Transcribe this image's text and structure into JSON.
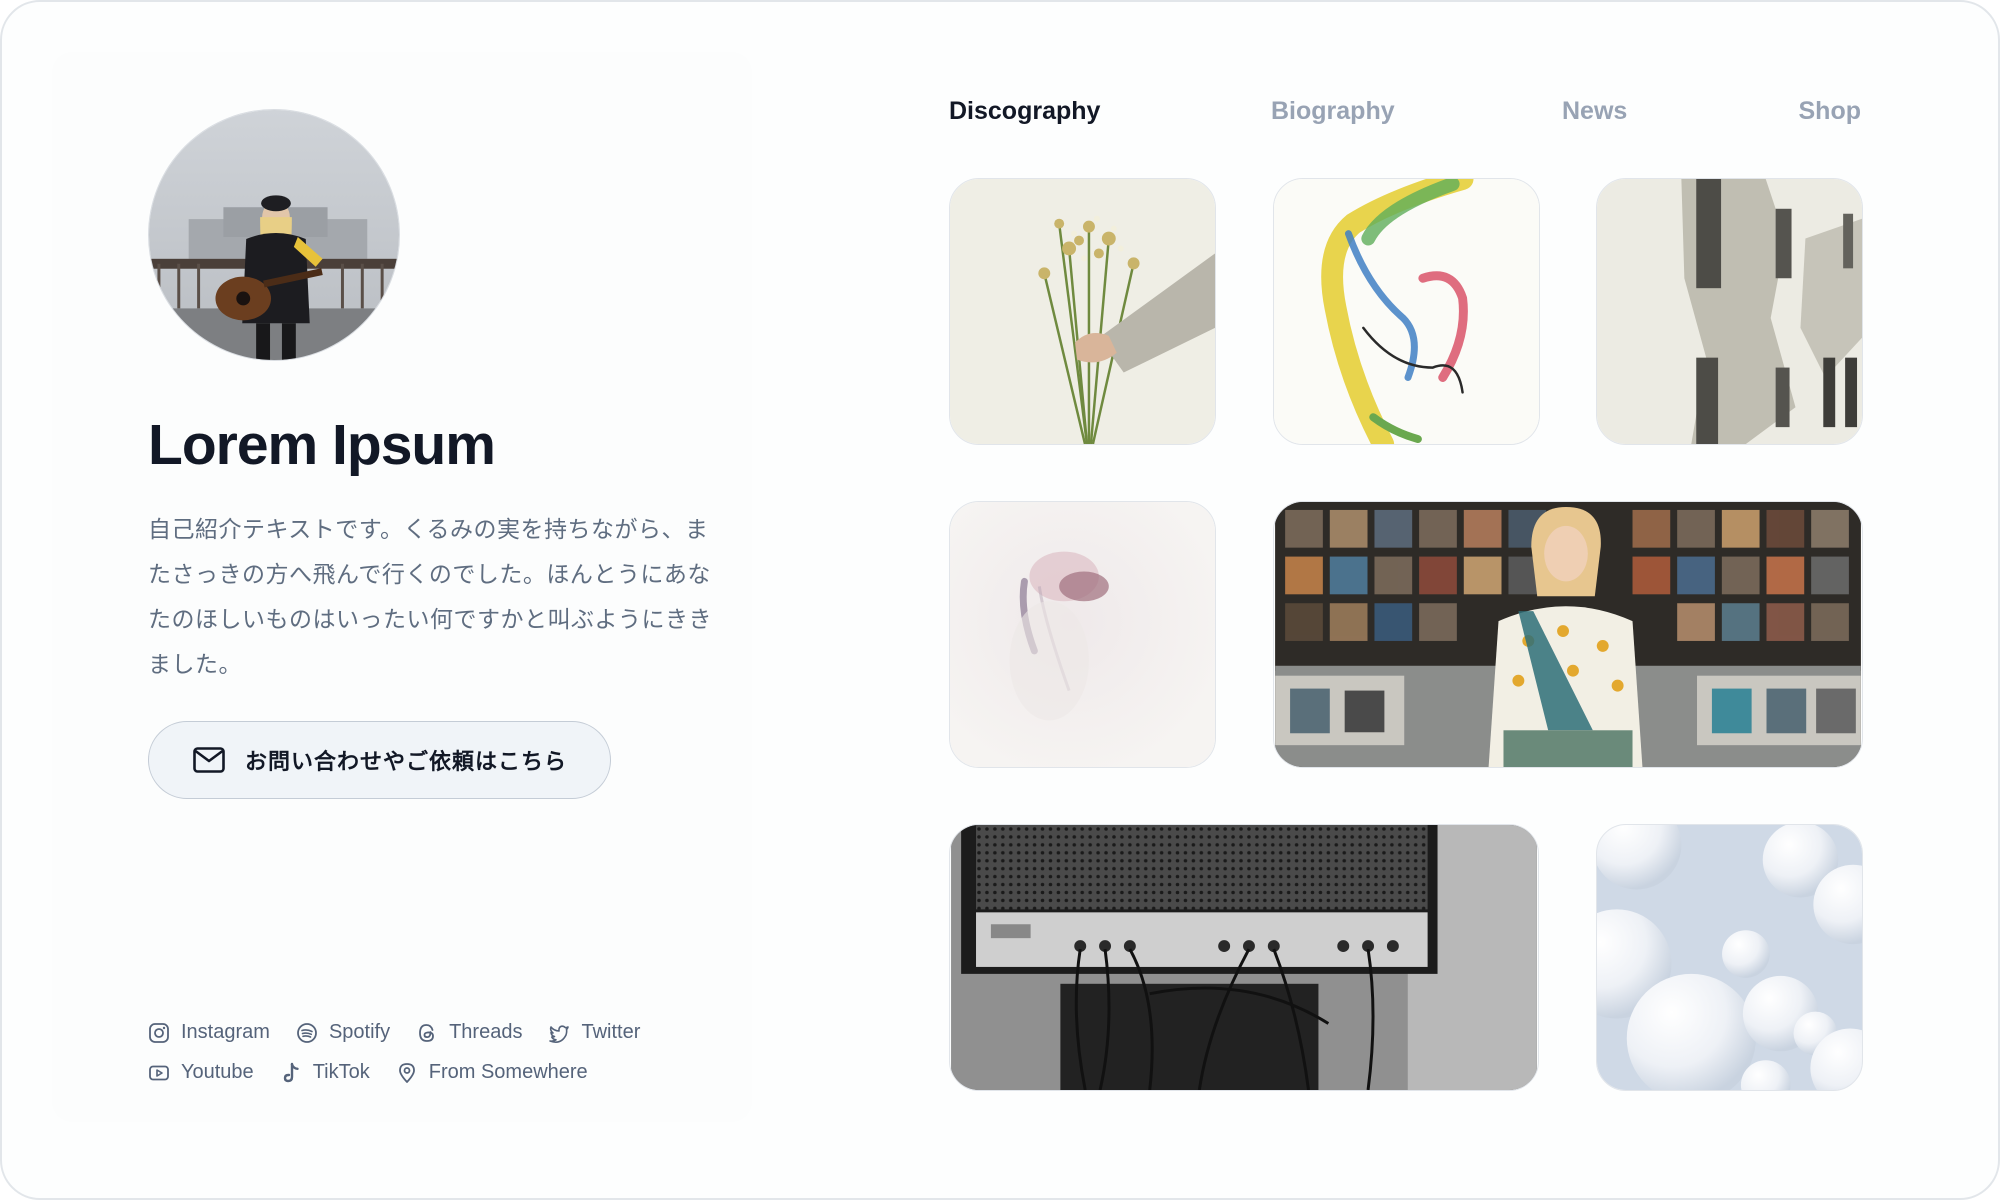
{
  "profile": {
    "name": "Lorem Ipsum",
    "bio": "自己紹介テキストです。くるみの実を持ちながら、またさっきの方へ飛んで行くのでした。ほんとうにあなたのほしいものはいったい何ですかと叫ぶようにききました。",
    "contact_label": "お問い合わせやご依頼はこちら"
  },
  "social": {
    "row1": [
      {
        "label": "Instagram",
        "icon": "instagram-icon"
      },
      {
        "label": "Spotify",
        "icon": "spotify-icon"
      },
      {
        "label": "Threads",
        "icon": "threads-icon"
      },
      {
        "label": "Twitter",
        "icon": "twitter-icon"
      }
    ],
    "row2": [
      {
        "label": "Youtube",
        "icon": "youtube-icon"
      },
      {
        "label": "TikTok",
        "icon": "tiktok-icon"
      },
      {
        "label": "From Somewhere",
        "icon": "location-pin-icon"
      }
    ]
  },
  "nav": {
    "tabs": [
      {
        "label": "Discography",
        "active": true
      },
      {
        "label": "Biography",
        "active": false
      },
      {
        "label": "News",
        "active": false
      },
      {
        "label": "Shop",
        "active": false
      }
    ]
  },
  "colors": {
    "heading": "#121826",
    "muted_text": "#5f6d80",
    "inactive_tab": "#98a3b4",
    "button_bg": "#f0f4f8"
  }
}
